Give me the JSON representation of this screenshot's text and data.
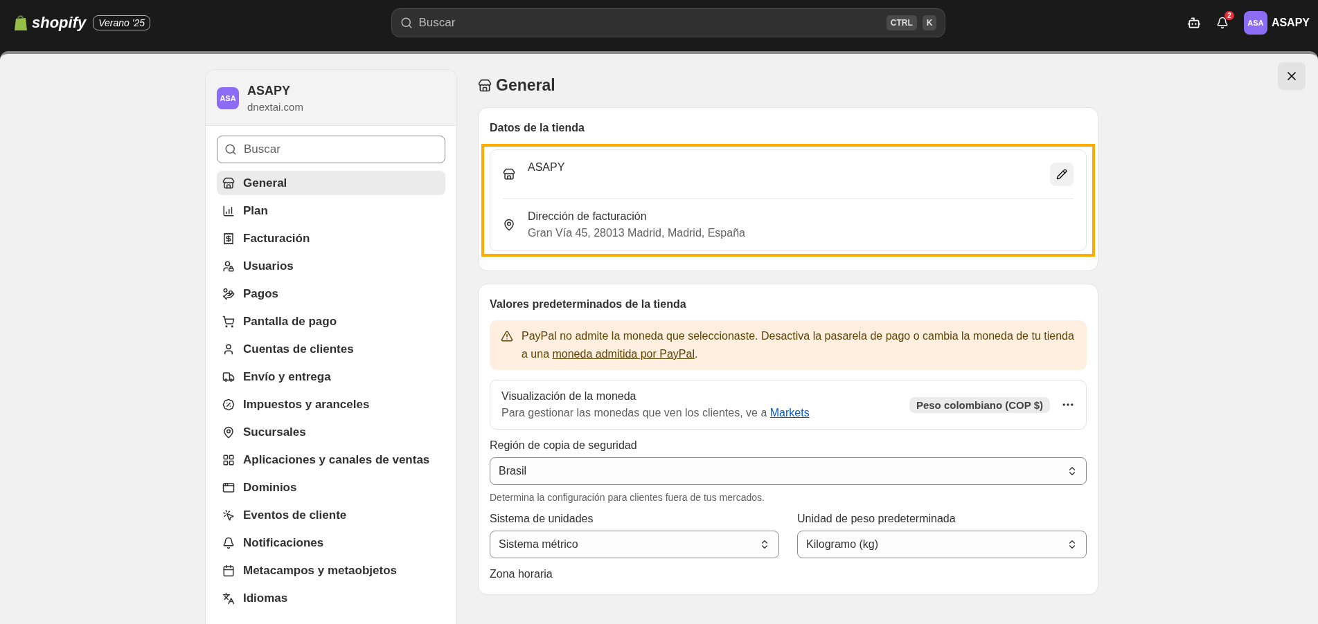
{
  "topbar": {
    "logo": "shopify",
    "edition_badge": "Verano '25",
    "search": {
      "placeholder": "Buscar",
      "shortcut_keys": [
        "CTRL",
        "K"
      ]
    },
    "notifications_count": "2",
    "account": {
      "initials": "ASA",
      "name": "ASAPY"
    }
  },
  "sidebar": {
    "store": {
      "initials": "ASA",
      "name": "ASAPY",
      "domain": "dnextai.com"
    },
    "search": {
      "placeholder": "Buscar"
    },
    "items": [
      {
        "label": "General",
        "selected": true
      },
      {
        "label": "Plan",
        "selected": false
      },
      {
        "label": "Facturación",
        "selected": false
      },
      {
        "label": "Usuarios",
        "selected": false
      },
      {
        "label": "Pagos",
        "selected": false
      },
      {
        "label": "Pantalla de pago",
        "selected": false
      },
      {
        "label": "Cuentas de clientes",
        "selected": false
      },
      {
        "label": "Envío y entrega",
        "selected": false
      },
      {
        "label": "Impuestos y aranceles",
        "selected": false
      },
      {
        "label": "Sucursales",
        "selected": false
      },
      {
        "label": "Aplicaciones y canales de ventas",
        "selected": false
      },
      {
        "label": "Dominios",
        "selected": false
      },
      {
        "label": "Eventos de cliente",
        "selected": false
      },
      {
        "label": "Notificaciones",
        "selected": false
      },
      {
        "label": "Metacampos y metaobjetos",
        "selected": false
      },
      {
        "label": "Idiomas",
        "selected": false
      }
    ]
  },
  "page": {
    "title": "General",
    "store_details": {
      "heading": "Datos de la tienda",
      "highlighted": true,
      "name": "ASAPY",
      "billing_label": "Dirección de facturación",
      "billing_address": "Gran Vía 45, 28013 Madrid, Madrid, España"
    },
    "defaults": {
      "heading": "Valores predeterminados de la tienda",
      "warning": {
        "text": "PayPal no admite la moneda que seleccionaste. Desactiva la pasarela de pago o cambia la moneda de tu tienda a una ",
        "link": "moneda admitida por PayPal",
        "after": "."
      },
      "currency": {
        "title": "Visualización de la moneda",
        "text": "Para gestionar las monedas que ven los clientes, ve a ",
        "link": "Markets",
        "badge": "Peso colombiano (COP $)"
      },
      "backup_region": {
        "label": "Región de copia de seguridad",
        "value": "Brasil",
        "help": "Determina la configuración para clientes fuera de tus mercados."
      },
      "unit_system": {
        "label": "Sistema de unidades",
        "value": "Sistema métrico"
      },
      "weight_unit": {
        "label": "Unidad de peso predeterminada",
        "value": "Kilogramo (kg)"
      },
      "timezone": {
        "label": "Zona horaria"
      }
    }
  }
}
